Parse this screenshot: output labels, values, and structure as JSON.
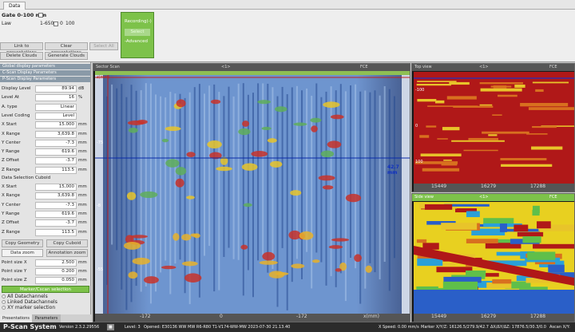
{
  "tabs": {
    "data": "Data"
  },
  "gate": {
    "title": "Gate 0-100 mm",
    "law_label": "Law",
    "law_range": "1-650",
    "value1": "0",
    "value2": "100"
  },
  "top_buttons": {
    "link_to_presentations": "Link to presentations",
    "clear_presentations": "Clear presentations",
    "select_all": "Select All",
    "delete_clouds": "Delete Clouds",
    "generate_clouds": "Generate Clouds"
  },
  "recording": {
    "label": "Recording(-)",
    "select": "Select",
    "advanced": "-Advanced"
  },
  "sections": {
    "global_display": "Global display parameters",
    "cscan_display": "C-Scan Display Parameters",
    "pscan_display": "P-Scan Display Parameters",
    "data_selection": "Data Selection Cuboid"
  },
  "params": [
    {
      "label": "Display Level",
      "value": "89.94",
      "unit": "dB"
    },
    {
      "label": "Level At",
      "value": "16",
      "unit": "%"
    },
    {
      "label": "A. type",
      "value": "Linear",
      "unit": ""
    },
    {
      "label": "Level Coding",
      "value": "Level",
      "unit": ""
    },
    {
      "label": "X Start",
      "value": "15.000",
      "unit": "mm"
    },
    {
      "label": "X Range",
      "value": "3,639.8",
      "unit": "mm"
    },
    {
      "label": "Y Center",
      "value": "-7.3",
      "unit": "mm"
    },
    {
      "label": "Y Range",
      "value": "619.6",
      "unit": "mm"
    },
    {
      "label": "Z Offset",
      "value": "-3.7",
      "unit": "mm"
    },
    {
      "label": "Z Range",
      "value": "113.5",
      "unit": "mm"
    }
  ],
  "cuboid": [
    {
      "label": "X Start",
      "value": "15,000",
      "unit": "mm"
    },
    {
      "label": "X Range",
      "value": "3,639.8",
      "unit": "mm"
    },
    {
      "label": "Y Center",
      "value": "-7.3",
      "unit": "mm"
    },
    {
      "label": "Y Range",
      "value": "619.6",
      "unit": "mm"
    },
    {
      "label": "Z Offset",
      "value": "-3.7",
      "unit": "mm"
    },
    {
      "label": "Z Range",
      "value": "113.5",
      "unit": "mm"
    }
  ],
  "cuboid_buttons": {
    "copy_geometry": "Copy Geometry",
    "copy_cuboid": "Copy Cuboid",
    "data_zoom": "Data zoom",
    "annotation_zoom": "Annotation zoom"
  },
  "point_size": [
    {
      "label": "Point size X",
      "value": "2.500",
      "unit": "mm"
    },
    {
      "label": "Point size Y",
      "value": "0.200",
      "unit": "mm"
    },
    {
      "label": "Point size Z",
      "value": "0.050",
      "unit": "mm"
    }
  ],
  "marker_btn": "Marker/Cscan selection",
  "radio": {
    "all": "All Datachannels",
    "linked": "Linked Datachannels",
    "xy": "XY marker selection"
  },
  "bottom_tabs": {
    "presentations": "Presentations",
    "parameters": "Parameters"
  },
  "sector": {
    "title": "Sector Scan",
    "mid": "<1>",
    "fce": "FCE",
    "zmm": "z(mm)",
    "depth_label": "42.7 mm",
    "y_ticks": [
      "-75",
      "-8",
      "-55"
    ],
    "x_ticks": [
      "-172",
      "0",
      "-172"
    ],
    "x_unit": "x(mm)"
  },
  "top_view": {
    "title": "Top view",
    "mid": "<1>",
    "fce": "FCE",
    "y_ticks": [
      "-100",
      "0",
      "100"
    ],
    "x_ticks": [
      "15449",
      "16279",
      "17288"
    ]
  },
  "side_view": {
    "title": "Side view",
    "mid": "<1>",
    "fce": "FCE",
    "x_ticks": [
      "15449",
      "16279",
      "17288"
    ]
  },
  "status": {
    "app": "P-Scan System",
    "version": "Version 2.3.2.29556",
    "level": "Level: 3",
    "opened": "Opened: E30136 WW MW R6-R80 T1-V174-WW-MW 2023-07-30 21.13.40",
    "xspeed": "X Speed: 0.00 mm/s",
    "marker": "Marker X/Y/Z: 16126.5/279.9/42.7",
    "delta": "ΔX/ΔY/ΔZ: 17876.5/30.3/0.0",
    "ascan": "Ascan X/Y:"
  },
  "colors": {
    "accent_green": "#7dc24a",
    "status_bg": "#2b2b2b"
  }
}
